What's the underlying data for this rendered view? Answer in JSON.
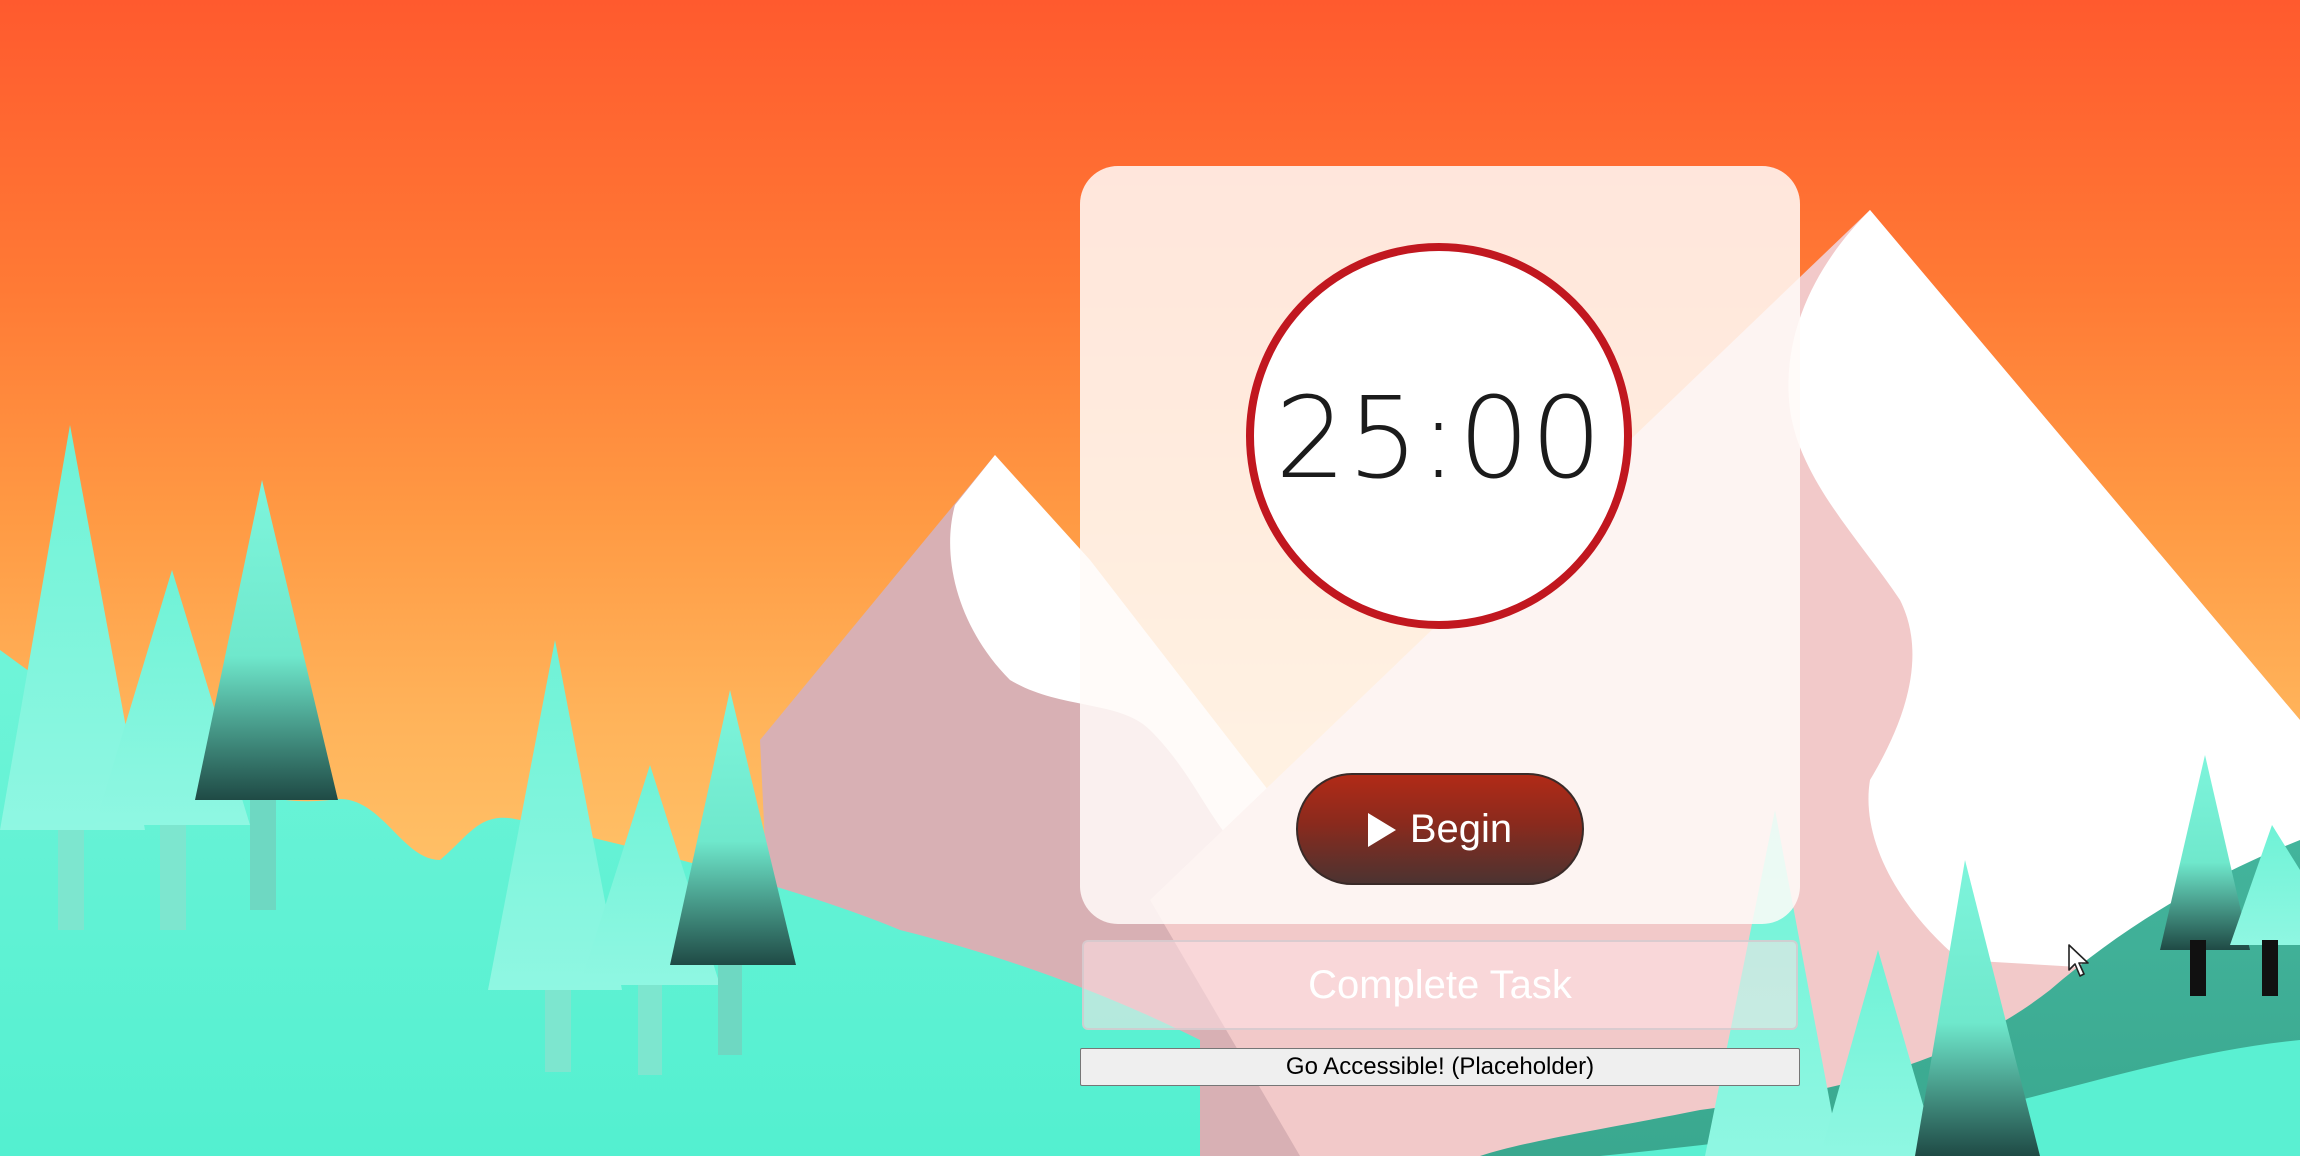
{
  "timer": {
    "display": "25:00"
  },
  "controls": {
    "begin_label": "Begin",
    "complete_task_label": "Complete Task",
    "accessible_label": "Go Accessible! (Placeholder)"
  },
  "icons": {
    "play": "play-icon",
    "cursor": "mouse-pointer-icon"
  },
  "colors": {
    "sky_top": "#ff5a2e",
    "sky_bottom": "#ffd07a",
    "ring": "#c1171f",
    "begin_button": "#8a2a1d",
    "trees": "#5cf2d3",
    "mountain_snow": "#ffffff",
    "mountain_shadow": "#d9b0b5"
  }
}
